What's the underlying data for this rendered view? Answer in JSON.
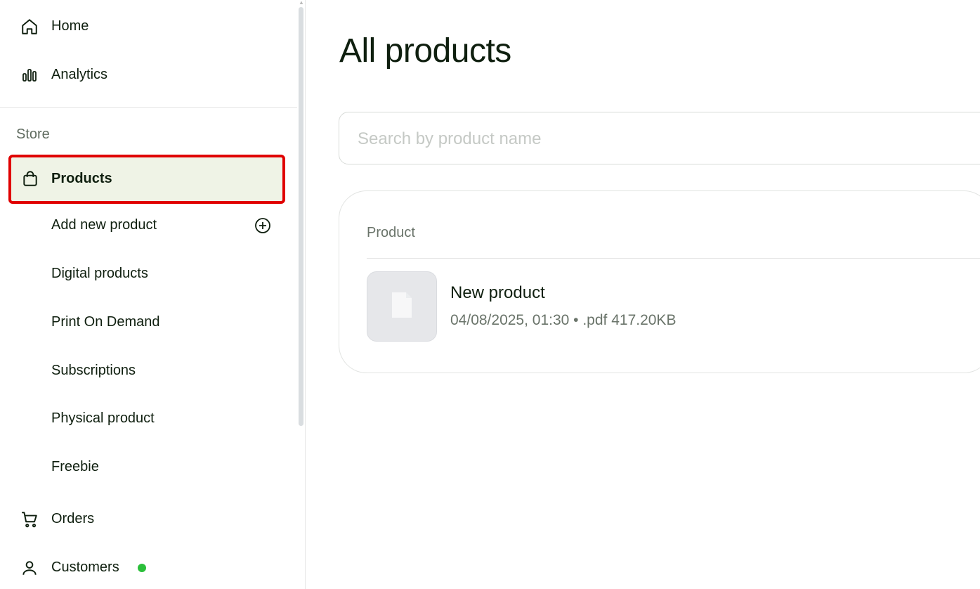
{
  "sidebar": {
    "home": {
      "label": "Home",
      "icon": "home-icon"
    },
    "analytics": {
      "label": "Analytics",
      "icon": "bar-chart-icon"
    },
    "section_label": "Store",
    "products": {
      "label": "Products",
      "icon": "shopping-bag-icon"
    },
    "sub_items": [
      {
        "label": "Add new product",
        "icon": "plus-circle-icon"
      },
      {
        "label": "Digital products"
      },
      {
        "label": "Print On Demand"
      },
      {
        "label": "Subscriptions"
      },
      {
        "label": "Physical product"
      },
      {
        "label": "Freebie"
      }
    ],
    "orders": {
      "label": "Orders",
      "icon": "cart-icon"
    },
    "customers": {
      "label": "Customers",
      "icon": "user-icon",
      "status_color": "#2bbf3a"
    }
  },
  "main": {
    "title": "All products",
    "search": {
      "placeholder": "Search by product name",
      "value": ""
    },
    "table": {
      "column_header": "Product",
      "rows": [
        {
          "name": "New product",
          "meta": "04/08/2025, 01:30 • .pdf 417.20KB",
          "thumbnail_icon": "file-icon"
        }
      ]
    }
  },
  "colors": {
    "accent_highlight": "#e00000",
    "selected_bg": "#eff3e6",
    "text_dark": "#0f1f0f"
  }
}
